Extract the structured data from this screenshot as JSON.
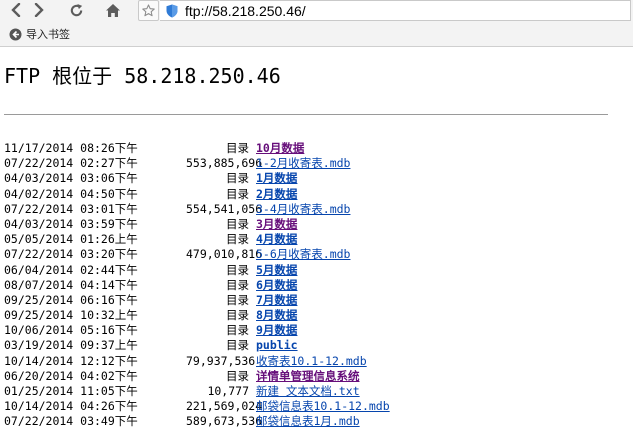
{
  "browser": {
    "url": "ftp://58.218.250.46/",
    "bookmarks_bar": {
      "import_label": "导入书签"
    }
  },
  "page": {
    "title": "FTP 根位于 58.218.250.46",
    "rows": [
      {
        "date": "11/17/2014 08:26下午",
        "size": "目录",
        "name": "10月数据",
        "dir": true,
        "visited": true
      },
      {
        "date": "07/22/2014 02:27下午",
        "size": "553,885,696",
        "name": "1-2月收寄表.mdb",
        "dir": false,
        "visited": false
      },
      {
        "date": "04/03/2014 03:06下午",
        "size": "目录",
        "name": "1月数据",
        "dir": true,
        "visited": false
      },
      {
        "date": "04/02/2014 04:50下午",
        "size": "目录",
        "name": "2月数据",
        "dir": true,
        "visited": false
      },
      {
        "date": "07/22/2014 03:01下午",
        "size": "554,541,056",
        "name": "3-4月收寄表.mdb",
        "dir": false,
        "visited": false
      },
      {
        "date": "04/03/2014 03:59下午",
        "size": "目录",
        "name": "3月数据",
        "dir": true,
        "visited": true
      },
      {
        "date": "05/05/2014 01:26上午",
        "size": "目录",
        "name": "4月数据",
        "dir": true,
        "visited": false
      },
      {
        "date": "07/22/2014 03:20下午",
        "size": "479,010,816",
        "name": "5-6月收寄表.mdb",
        "dir": false,
        "visited": false
      },
      {
        "date": "06/04/2014 02:44下午",
        "size": "目录",
        "name": "5月数据",
        "dir": true,
        "visited": false
      },
      {
        "date": "08/07/2014 04:14下午",
        "size": "目录",
        "name": "6月数据",
        "dir": true,
        "visited": false
      },
      {
        "date": "09/25/2014 06:16下午",
        "size": "目录",
        "name": "7月数据",
        "dir": true,
        "visited": false
      },
      {
        "date": "09/25/2014 10:32上午",
        "size": "目录",
        "name": "8月数据",
        "dir": true,
        "visited": false
      },
      {
        "date": "10/06/2014 05:16下午",
        "size": "目录",
        "name": "9月数据",
        "dir": true,
        "visited": false
      },
      {
        "date": "03/19/2014 09:37上午",
        "size": "目录",
        "name": "public",
        "dir": true,
        "visited": false
      },
      {
        "date": "10/14/2014 12:12下午",
        "size": "79,937,536",
        "name": "收寄表10.1-12.mdb",
        "dir": false,
        "visited": false
      },
      {
        "date": "06/20/2014 04:02下午",
        "size": "目录",
        "name": "详情单管理信息系统",
        "dir": true,
        "visited": true
      },
      {
        "date": "01/25/2014 11:05下午",
        "size": "10,777",
        "name": "新建 文本文档.txt",
        "dir": false,
        "visited": false
      },
      {
        "date": "10/14/2014 04:26下午",
        "size": "221,569,024",
        "name": "邮袋信息表10.1-12.mdb",
        "dir": false,
        "visited": false
      },
      {
        "date": "07/22/2014 03:49下午",
        "size": "589,673,536",
        "name": "邮袋信息表1月.mdb",
        "dir": false,
        "visited": false
      }
    ]
  },
  "colors": {
    "link": "#0645ad",
    "visited_link": "#660e7a",
    "chrome_bg": "#f3f3f3"
  },
  "icons": [
    "back-arrow-icon",
    "forward-arrow-icon",
    "reload-icon",
    "home-icon",
    "star-icon",
    "shield-icon",
    "import-bookmarks-icon"
  ]
}
